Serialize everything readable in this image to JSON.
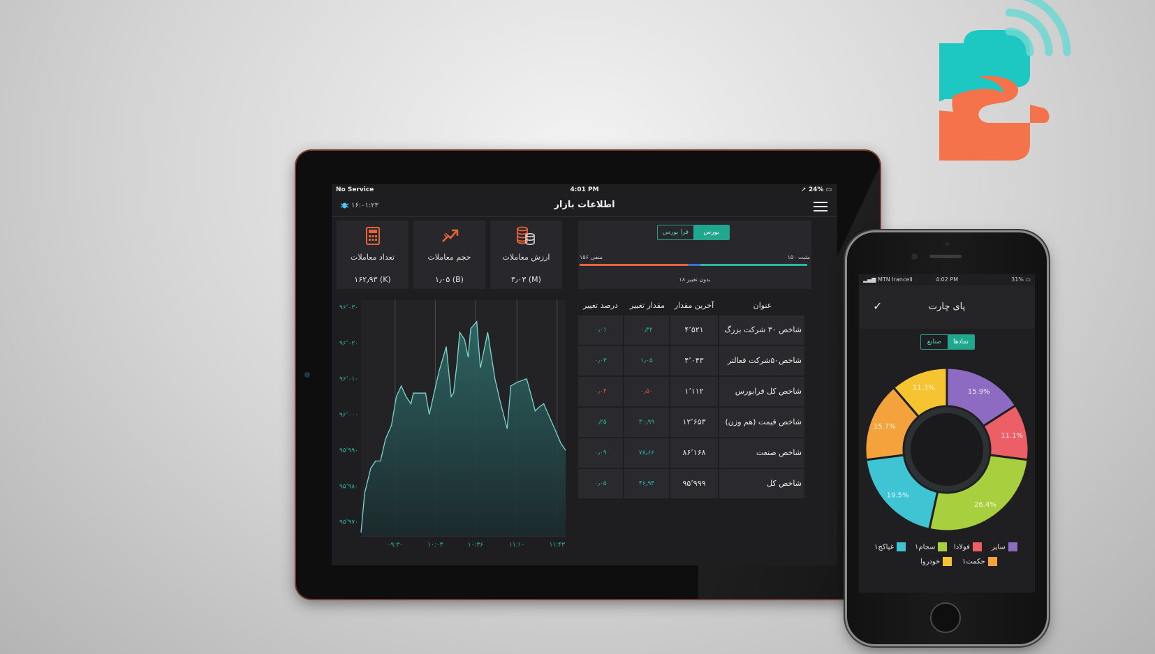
{
  "colors": {
    "accent": "#1fa88e",
    "positive": "#2ab7a5",
    "negative": "#e8513b",
    "chart_line": "#7fd4d0",
    "logo_teal": "#1cc8c1",
    "logo_orange": "#f4734b"
  },
  "tablet": {
    "status": {
      "left": "No Service",
      "time": "4:01 PM",
      "battery": "24%"
    },
    "nav": {
      "title": "اطلاعات بازار",
      "time": "۱۶:۰۱:۲۳",
      "menu_icon": "hamburger-icon",
      "left_icon": "bug-icon"
    },
    "stats": [
      {
        "label": "ارزش معاملات",
        "value": "۳٫۰۳ (M)",
        "icon": "coins-stack-icon"
      },
      {
        "label": "حجم معاملات",
        "value": "۱٫۰۵ (B)",
        "icon": "trend-arrow-icon"
      },
      {
        "label": "تعداد معاملات",
        "value": "۱۶۲٫۹۳ (K)",
        "icon": "calculator-icon"
      }
    ],
    "market": {
      "tabs": [
        "بورس",
        "فرا بورس"
      ],
      "active_tab": "بورس",
      "negative_label": "منفی ۱۵۶",
      "positive_label": "۱۵۰ مثبت",
      "neutral_label": "بدون تغییر ۱۸"
    },
    "table": {
      "headers": [
        "عنوان",
        "آخرین مقدار",
        "مقدار تغییر",
        "درصد تغییر"
      ],
      "rows": [
        {
          "title": "شاخص ۳۰ شرکت بزرگ",
          "last": "۴٬۵۲۱",
          "change": "۰٫۳۲",
          "percent": "۰٫۰۱",
          "direction": "up"
        },
        {
          "title": "شاخص۵۰شرکت فعالتر",
          "last": "۴٬۰۴۳",
          "change": "۱٫۰۵",
          "percent": "۰٫۰۳",
          "direction": "up"
        },
        {
          "title": "شاخص کل فرابورس",
          "last": "۱٬۱۱۲",
          "change": "۰٫۵۰",
          "percent": "۰٫۰۴",
          "direction": "down"
        },
        {
          "title": "شاخص قیمت (هم وزن)",
          "last": "۱۲٬۶۵۳",
          "change": "۳۰٫۹۹",
          "percent": "۰٫۲۵",
          "direction": "up"
        },
        {
          "title": "شاخص صنعت",
          "last": "۸۶٬۱۶۸",
          "change": "۷۸٫۶۶",
          "percent": "۰٫۰۹",
          "direction": "up"
        },
        {
          "title": "شاخص کل",
          "last": "۹۵٬۹۹۹",
          "change": "۴۶٫۹۴",
          "percent": "۰٫۰۵",
          "direction": "up"
        }
      ]
    }
  },
  "chart_data": [
    {
      "type": "area",
      "title": "",
      "xlabel": "",
      "ylabel": "",
      "y_ticks": [
        "۹۶٬۰۳۰",
        "۹۶٬۰۲۰",
        "۹۶٬۰۱۰",
        "۹۶٬۰۰۰",
        "۹۵٬۹۹۰",
        "۹۵٬۹۸۰",
        "۹۵٬۹۷۰"
      ],
      "y_tick_values": [
        96030,
        96020,
        96010,
        96000,
        95990,
        95980,
        95970
      ],
      "x_ticks": [
        "۰۹:۳۰",
        "۱۰:۰۳",
        "۱۰:۳۶",
        "۱۱:۱۰",
        "۱۱:۴۳"
      ],
      "x_tick_values": [
        0,
        33,
        66,
        100,
        133
      ],
      "ylim": [
        95966,
        96032
      ],
      "xlim": [
        -28,
        140
      ],
      "grid": "vertical",
      "series": [
        {
          "x": [
            -28,
            -25,
            -20,
            -16,
            -12,
            -8,
            -3,
            1,
            5,
            9,
            13,
            15,
            19,
            25,
            28,
            36,
            42,
            46,
            48,
            51,
            53,
            57,
            60,
            62,
            67,
            70,
            76,
            82,
            86,
            92,
            95,
            100,
            108,
            112,
            115,
            118,
            122,
            131,
            136,
            140
          ],
          "y": [
            95967,
            95978,
            95985,
            95987,
            95987,
            95993,
            95997,
            96005,
            96008,
            96005,
            96003,
            96006,
            96006,
            96006,
            96000,
            96012,
            96019,
            96005,
            96006,
            96015,
            96023,
            96021,
            96016,
            96024,
            96026,
            96013,
            96023,
            96010,
            96004,
            95996,
            96008,
            96009,
            96010,
            96005,
            96001,
            96002,
            96003,
            95996,
            95992,
            95990
          ]
        }
      ]
    },
    {
      "type": "pie",
      "title": "پای چارت",
      "donut": true,
      "slices": [
        {
          "name": "سایر",
          "value": 15.9,
          "label": "15.9%",
          "color": "#8e6bc2"
        },
        {
          "name": "فولادا",
          "value": 11.1,
          "label": "11.1%",
          "color": "#ec5f66"
        },
        {
          "name": "",
          "value": 26.4,
          "label": "26.4%",
          "color": "#a8cf3d"
        },
        {
          "name": "غیاکج۱",
          "value": 19.5,
          "label": "19.5%",
          "color": "#3fc4d4"
        },
        {
          "name": "حکمت۱",
          "value": 15.7,
          "label": "15.7%",
          "color": "#f4a23c"
        },
        {
          "name": "خودروا",
          "value": 11.3,
          "label": "11.3%",
          "color": "#f6c331"
        }
      ],
      "legend": [
        {
          "name": "سایر",
          "color": "#8e6bc2"
        },
        {
          "name": "فولادا",
          "color": "#ec5f66"
        },
        {
          "name": "سجام۱",
          "color": "#a8cf3d"
        },
        {
          "name": "غیاکج۱",
          "color": "#3fc4d4"
        },
        {
          "name": "حکمت۱",
          "color": "#f4a23c"
        },
        {
          "name": "خودروا",
          "color": "#f6c331"
        }
      ]
    }
  ],
  "phone": {
    "status": {
      "carrier": "MTN Irancell",
      "time": "4:02 PM",
      "battery": "31%"
    },
    "title": "پای چارت",
    "check_icon": "checkmark-icon",
    "tabs": [
      "نمادها",
      "صنایع"
    ],
    "active_tab": "نمادها"
  }
}
